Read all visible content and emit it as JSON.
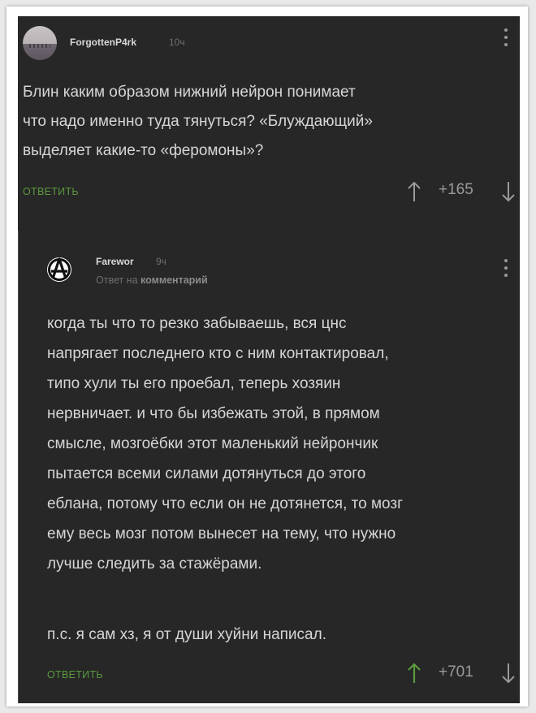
{
  "comment": {
    "username": "ForgottenP4rk",
    "time": "10ч",
    "text": "Блин каким образом нижний нейрон понимает\nчто надо именно туда тянуться? «Блуждающий»\nвыделяет какие-то «феромоны»?",
    "reply_label": "ОТВЕТИТЬ",
    "rating": "+165",
    "avatar_icon": "avatar-photo-icon"
  },
  "reply": {
    "username": "Farewor",
    "time": "9ч",
    "reply_to_prefix": "Ответ на",
    "reply_to_target": "комментарий",
    "text": "когда ты что то резко забываешь, вся цнс\nнапрягает последнего кто с ним контактировал,\nтипо хули ты его проебал, теперь хозяин\nнервничает. и что бы избежать этой, в прямом\nсмысле, мозгоёбки этот маленький нейрончик\nпытается всеми силами дотянуться до этого\nеблана, потому что если он не дотянется, то мозг\nему весь мозг потом вынесет на тему, что нужно\nлучше следить за стажёрами.",
    "postscript": "п.с. я сам хз, я от души хуйни написал.",
    "reply_label": "ОТВЕТИТЬ",
    "rating": "+701",
    "avatar_icon": "anarchy-symbol-icon"
  },
  "colors": {
    "background": "#272727",
    "text": "#d6d6d6",
    "reply_link": "#5b9a3e",
    "upvote_active": "#5b9a3e",
    "muted": "#9a9a9a"
  }
}
